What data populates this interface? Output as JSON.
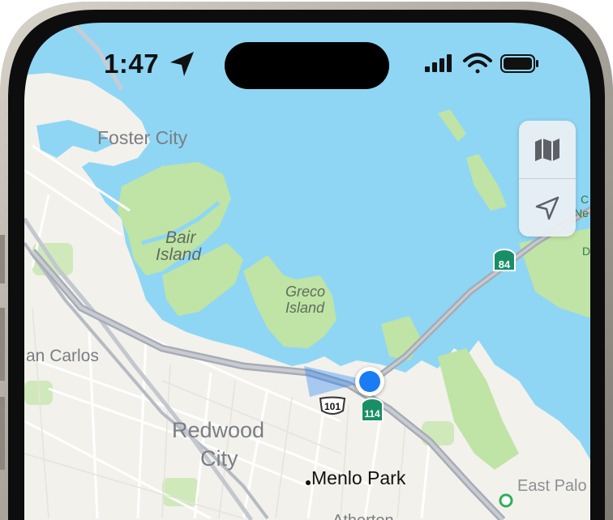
{
  "status_bar": {
    "time": "1:47",
    "location_icon": "location-arrow-icon",
    "signal_icon": "cellular-signal-icon",
    "wifi_icon": "wifi-icon",
    "battery_icon": "battery-icon"
  },
  "map_labels": {
    "foster_city": "Foster City",
    "bair_island_1": "Bair",
    "bair_island_2": "Island",
    "greco_island_1": "Greco",
    "greco_island_2": "Island",
    "san_carlos": "an Carlos",
    "redwood_city_1": "Redwood",
    "redwood_city_2": "City",
    "menlo_park": "Menlo Park",
    "east_palo": "East Palo",
    "atherton": "Atherton",
    "edge_1": "C",
    "edge_2": "Ne",
    "edge_3": "D"
  },
  "route_shields": {
    "us_101": "101",
    "ca_114": "114",
    "ca_84": "84"
  },
  "controls": {
    "map_mode_icon": "map-icon",
    "locate_icon": "location-arrow-outline-icon"
  },
  "colors": {
    "water": "#8fd6f5",
    "land": "#f3f1ec",
    "park": "#bfe4a5",
    "user_location": "#1a7cf5",
    "highway_shield": "#1a8f67"
  }
}
